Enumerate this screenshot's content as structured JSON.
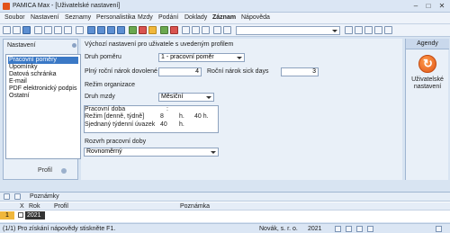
{
  "window": {
    "title": "PAMICA Max - [Uživatelské nastavení]",
    "controls": {
      "minimize": "–",
      "maximize": "□",
      "close": "✕"
    }
  },
  "menu": [
    {
      "label": "Soubor",
      "bold": false
    },
    {
      "label": "Nastavení",
      "bold": false
    },
    {
      "label": "Seznamy",
      "bold": false
    },
    {
      "label": "Personalistika",
      "bold": false
    },
    {
      "label": "Mzdy",
      "bold": false
    },
    {
      "label": "Podání",
      "bold": false
    },
    {
      "label": "Doklady",
      "bold": false
    },
    {
      "label": "Záznam",
      "bold": true
    },
    {
      "label": "Nápověda",
      "bold": false
    }
  ],
  "toolbar": {
    "icons": [
      "new-icon",
      "open-icon",
      "save-icon",
      "print-icon",
      "cut-icon",
      "copy-icon",
      "paste-icon",
      "undo-icon",
      "first-record-icon",
      "prev-record-icon",
      "next-record-icon",
      "last-record-icon",
      "add-record-icon",
      "delete-record-icon",
      "edit-record-icon",
      "ok-icon",
      "cancel-icon",
      "refresh-icon",
      "filter-icon",
      "search-icon",
      "list-icon",
      "calc-icon",
      "calendar-icon",
      "help-icon",
      "tools-icon",
      "grid-icon",
      "settings-icon"
    ],
    "combo_value": ""
  },
  "left_panel": {
    "header": "Nastavení",
    "items": [
      {
        "label": "Pracovní poměry",
        "selected": true
      },
      {
        "label": "Upomínky",
        "selected": false
      },
      {
        "label": "Datová schránka",
        "selected": false
      },
      {
        "label": "E-mail",
        "selected": false
      },
      {
        "label": "PDF elektronický podpis",
        "selected": false
      },
      {
        "label": "Ostatní",
        "selected": false
      }
    ],
    "profil_label": "Profil"
  },
  "form": {
    "section_title": "Výchozí nastavení pro uživatele s uvedeným profilem",
    "druh_pomeru_label": "Druh poměru",
    "druh_pomeru_value": "1 - pracovní poměr",
    "plny_rocni_label": "Plný roční nárok dovolené",
    "plny_rocni_value": "4",
    "rocni_sick_label": "Roční nárok sick days",
    "rocni_sick_value": "3",
    "rezim_organizace_label": "Režim organizace",
    "druh_mzdy_label": "Druh mzdy",
    "druh_mzdy_value": "Měsíční",
    "pracovni_doba_label": "Pracovní doba",
    "pracovni_doba_value": ":",
    "rezim_label": "Režim [denně, týdně]",
    "rezim_denne": "8",
    "rezim_denne_unit": "h.",
    "rezim_tydne": "40 h.",
    "sjednany_label": "Sjednaný týdenní úvazek",
    "sjednany_value": "40",
    "sjednany_unit": "h.",
    "rozvrh_label": "Rozvrh pracovní doby",
    "rozvrh_value": "Rovnoměrný"
  },
  "agenda": {
    "header": "Agendy",
    "item_label_line1": "Uživatelské",
    "item_label_line2": "nastavení"
  },
  "bottom": {
    "tab_label": "Poznámky",
    "columns": [
      "X",
      "Rok",
      "Profil",
      "Poznámka"
    ],
    "row": {
      "index": "1",
      "rok": "2021"
    }
  },
  "status": {
    "help_text": "(1/1) Pro získání nápovědy stiskněte F1.",
    "company": "Novák, s. r. o.",
    "year": "2021"
  }
}
